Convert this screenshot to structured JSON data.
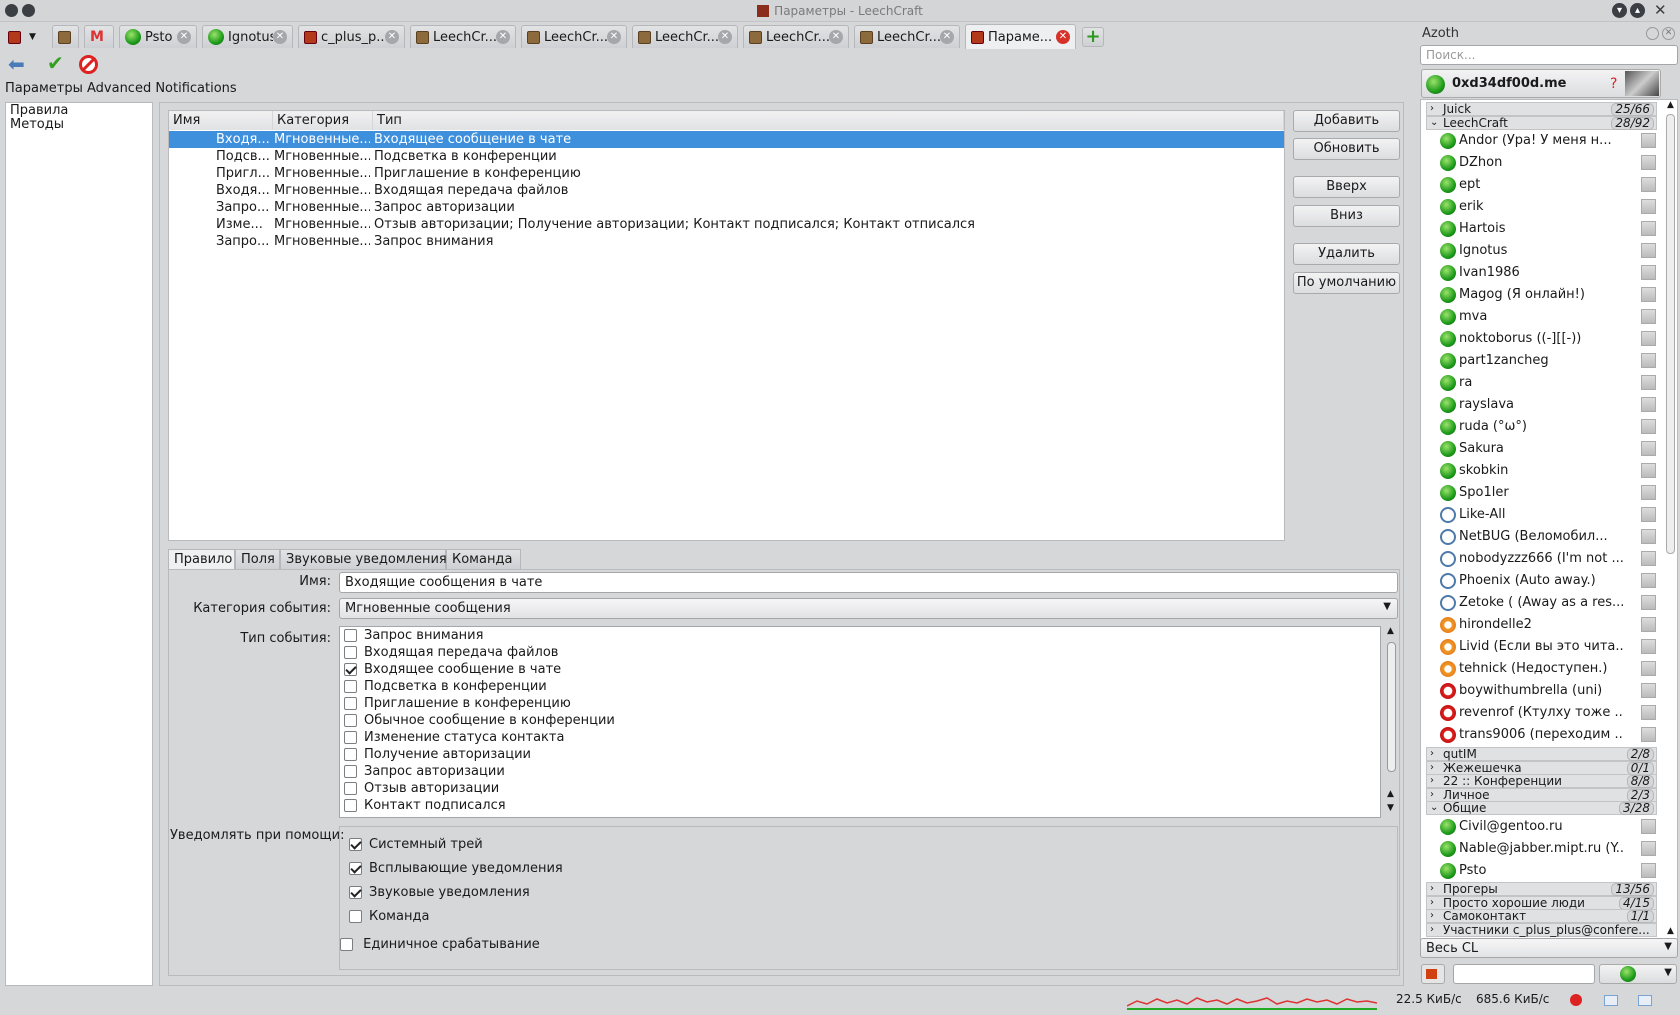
{
  "window": {
    "title": "Параметры - LeechCraft"
  },
  "tabs": [
    {
      "label": "Psto"
    },
    {
      "label": "Ignotus"
    },
    {
      "label": "c_plus_p..."
    },
    {
      "label": "LeechCr..."
    },
    {
      "label": "LeechCr..."
    },
    {
      "label": "LeechCr..."
    },
    {
      "label": "LeechCr..."
    },
    {
      "label": "LeechCr..."
    },
    {
      "label": "Параме..."
    }
  ],
  "page": {
    "label": "Параметры Advanced Notifications"
  },
  "left_list": [
    "Правила",
    "Методы"
  ],
  "table": {
    "headers": [
      "Имя",
      "Категория",
      "Тип"
    ],
    "rows": [
      {
        "name": "Входя...",
        "category": "Мгновенные...",
        "type": "Входящее сообщение в чате",
        "checked": true,
        "selected": true
      },
      {
        "name": "Подсв...",
        "category": "Мгновенные...",
        "type": "Подсветка в конференции",
        "checked": true
      },
      {
        "name": "Пригл...",
        "category": "Мгновенные...",
        "type": "Приглашение в конференцию",
        "checked": true
      },
      {
        "name": "Входя...",
        "category": "Мгновенные...",
        "type": "Входящая передача файлов",
        "checked": true
      },
      {
        "name": "Запро...",
        "category": "Мгновенные...",
        "type": "Запрос авторизации",
        "checked": true
      },
      {
        "name": "Изме...",
        "category": "Мгновенные...",
        "type": "Отзыв авторизации; Получение авторизации; Контакт подписался; Контакт отписался",
        "checked": true
      },
      {
        "name": "Запро...",
        "category": "Мгновенные...",
        "type": "Запрос внимания",
        "checked": true
      }
    ]
  },
  "buttons": {
    "add": "Добавить",
    "update": "Обновить",
    "up": "Вверх",
    "down": "Вниз",
    "remove": "Удалить",
    "defaults": "По умолчанию"
  },
  "subtabs": [
    "Правило",
    "Поля",
    "Звуковые уведомления",
    "Команда"
  ],
  "form": {
    "name_label": "Имя:",
    "name_value": "Входящие сообщения в чате",
    "category_label": "Категория события:",
    "category_value": "Мгновенные сообщения",
    "type_label": "Тип события:",
    "types": [
      {
        "label": "Запрос внимания",
        "checked": false
      },
      {
        "label": "Входящая передача файлов",
        "checked": false
      },
      {
        "label": "Входящее сообщение в чате",
        "checked": true
      },
      {
        "label": "Подсветка в конференции",
        "checked": false
      },
      {
        "label": "Приглашение в конференцию",
        "checked": false
      },
      {
        "label": "Обычное сообщение в конференции",
        "checked": false
      },
      {
        "label": "Изменение статуса контакта",
        "checked": false
      },
      {
        "label": "Получение авторизации",
        "checked": false
      },
      {
        "label": "Запрос авторизации",
        "checked": false
      },
      {
        "label": "Отзыв авторизации",
        "checked": false
      },
      {
        "label": "Контакт подписался",
        "checked": false
      }
    ],
    "notify_label": "Уведомлять при помощи:",
    "notify": [
      {
        "label": "Системный трей",
        "checked": true
      },
      {
        "label": "Всплывающие уведомления",
        "checked": true
      },
      {
        "label": "Звуковые уведомления",
        "checked": true
      },
      {
        "label": "Команда",
        "checked": false
      }
    ],
    "single_shot": {
      "label": "Единичное срабатывание",
      "checked": false
    }
  },
  "roster": {
    "title": "Azoth",
    "search_placeholder": "Поиск...",
    "account": "0xd34df00d.me",
    "groups_top": [
      {
        "name": "Juick",
        "count": "25/66",
        "expanded": false
      },
      {
        "name": "LeechCraft",
        "count": "28/92",
        "expanded": true
      }
    ],
    "contacts": [
      {
        "name": "Andor (Ура! У меня н...",
        "status": "online"
      },
      {
        "name": "DZhon",
        "status": "online"
      },
      {
        "name": "ept",
        "status": "online"
      },
      {
        "name": "erik",
        "status": "online"
      },
      {
        "name": "Hartois",
        "status": "online"
      },
      {
        "name": "Ignotus",
        "status": "online"
      },
      {
        "name": "Ivan1986",
        "status": "online"
      },
      {
        "name": "Magog (Я онлайн!)",
        "status": "online"
      },
      {
        "name": "mva",
        "status": "online"
      },
      {
        "name": "noktoborus ((-][[-))",
        "status": "online"
      },
      {
        "name": "part1zancheg",
        "status": "online"
      },
      {
        "name": "ra",
        "status": "online"
      },
      {
        "name": "rayslava",
        "status": "online"
      },
      {
        "name": "ruda (°ω°)",
        "status": "online"
      },
      {
        "name": "Sakura",
        "status": "online"
      },
      {
        "name": "skobkin",
        "status": "online"
      },
      {
        "name": "Spo1ler",
        "status": "online"
      },
      {
        "name": "Like-All",
        "status": "away"
      },
      {
        "name": "NetBUG (Веломобил...",
        "status": "away"
      },
      {
        "name": "nobodyzzz666 (I'm not ...",
        "status": "away"
      },
      {
        "name": "Phoenix (Auto away.)",
        "status": "away"
      },
      {
        "name": "Zetoke ( (Away as a res...",
        "status": "away"
      },
      {
        "name": "hirondelle2",
        "status": "xa"
      },
      {
        "name": "Livid (Если вы это чита...",
        "status": "xa"
      },
      {
        "name": "tehnick (Недоступен.)",
        "status": "xa"
      },
      {
        "name": "boywithumbrella (uni)",
        "status": "dnd"
      },
      {
        "name": "revenrof (Ктулху тоже ...",
        "status": "dnd"
      },
      {
        "name": "trans9006 (переходим ...",
        "status": "dnd"
      }
    ],
    "groups_mid": [
      {
        "name": "qutIM",
        "count": "2/8",
        "expanded": false
      },
      {
        "name": "Жежешечка",
        "count": "0/1",
        "expanded": false
      },
      {
        "name": "22 :: Конференции",
        "count": "8/8",
        "expanded": false
      },
      {
        "name": "Личное",
        "count": "2/3",
        "expanded": false
      },
      {
        "name": "Общие",
        "count": "3/28",
        "expanded": true
      }
    ],
    "contacts2": [
      {
        "name": "Civil@gentoo.ru",
        "status": "online"
      },
      {
        "name": "Nable@jabber.mipt.ru (Y...",
        "status": "online"
      },
      {
        "name": "Psto",
        "status": "online"
      }
    ],
    "groups_bottom": [
      {
        "name": "Прогеры",
        "count": "13/56"
      },
      {
        "name": "Просто хорошие люди",
        "count": "4/15"
      },
      {
        "name": "Самоконтакт",
        "count": "1/1"
      },
      {
        "name": "Участники c_plus_plus@confere...",
        "count": ""
      }
    ],
    "filter": "Весь CL"
  },
  "status": {
    "down": "22.5 КиБ/с",
    "up": "685.6 КиБ/с"
  },
  "colors": {
    "selection": "#3e8fdc",
    "online": "#1e9b1b",
    "dnd": "#d22222",
    "close_active": "#d6322a"
  }
}
